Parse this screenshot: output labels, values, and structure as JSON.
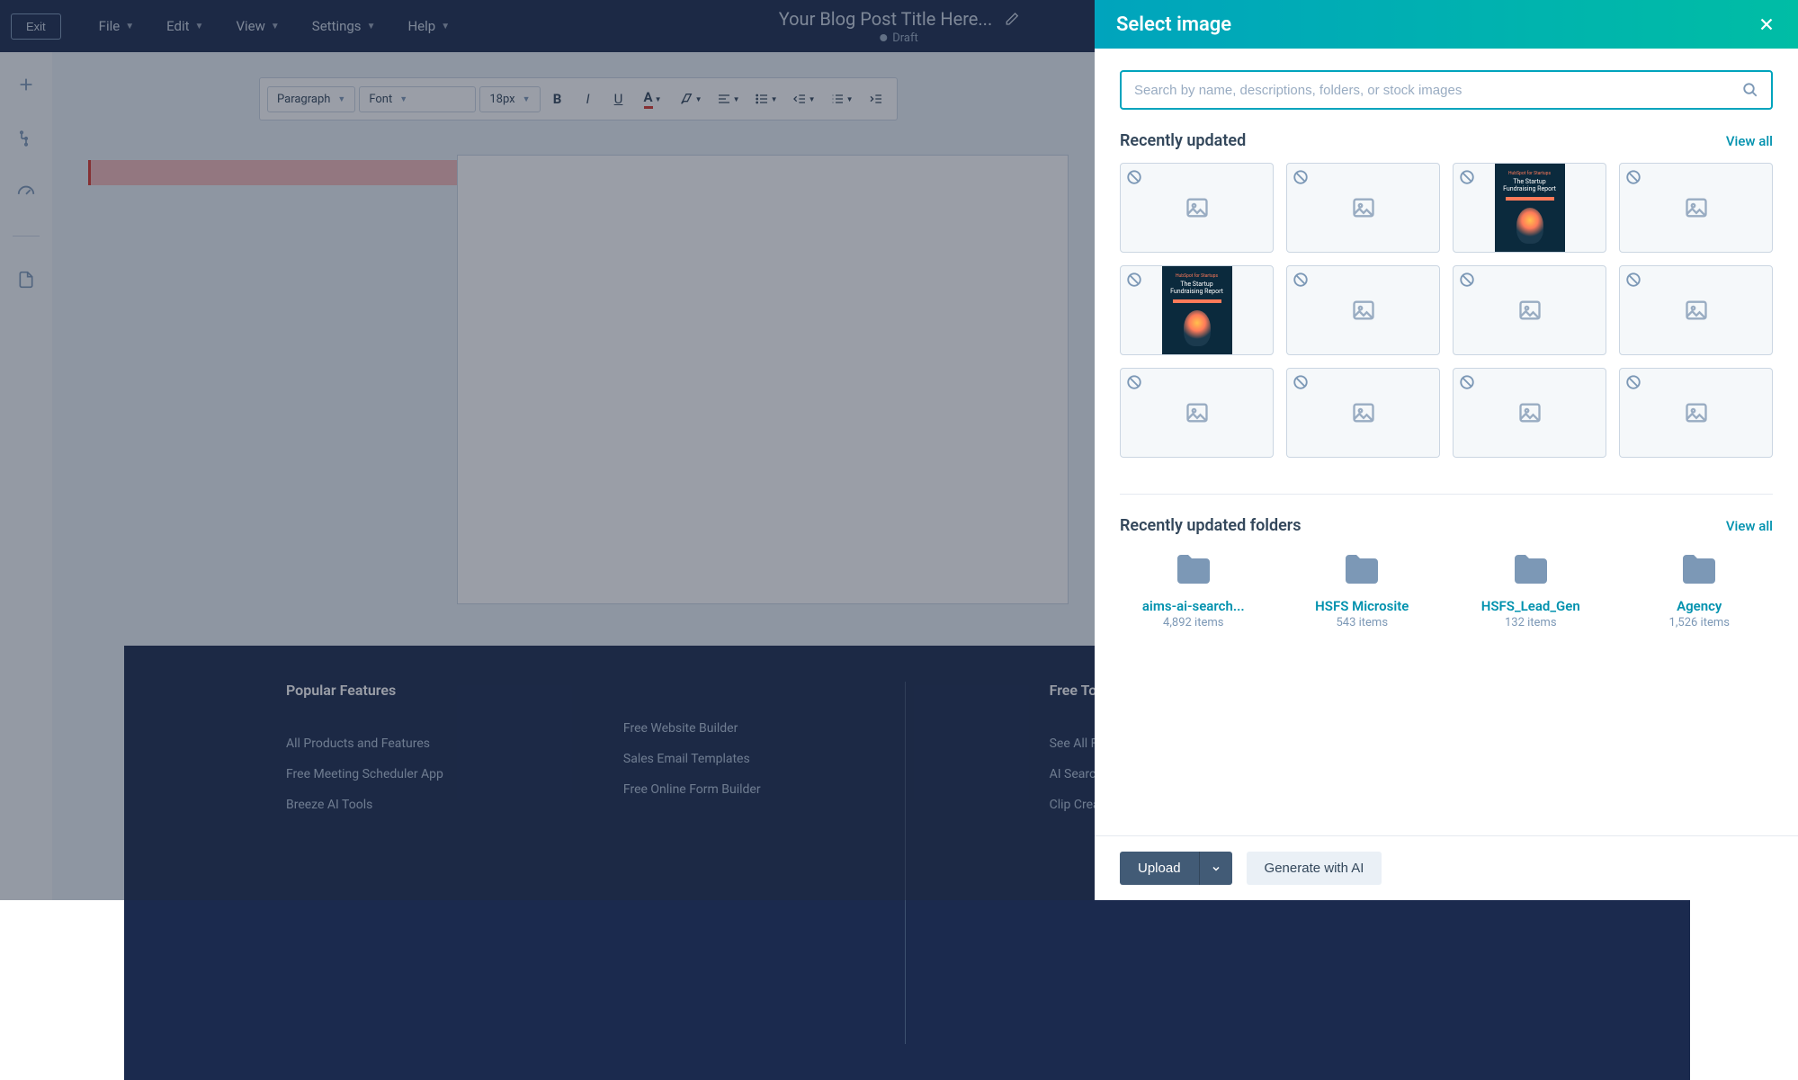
{
  "topbar": {
    "exit": "Exit",
    "menus": [
      "File",
      "Edit",
      "View",
      "Settings",
      "Help"
    ],
    "title": "Your Blog Post Title Here...",
    "status": "Draft"
  },
  "toolbar": {
    "paragraph": "Paragraph",
    "font": "Font",
    "size": "18px"
  },
  "footer": {
    "col1_title": "Popular Features",
    "col1_links": [
      "All Products and Features",
      "Free Meeting Scheduler App",
      "Breeze AI Tools"
    ],
    "col2_links": [
      "Free Website Builder",
      "Sales Email Templates",
      "Free Online Form Builder"
    ],
    "col3_title": "Free Tools",
    "col3_links": [
      "See All Free Business Tools",
      "AI Search Grader",
      "Clip Creator"
    ]
  },
  "panel": {
    "title": "Select image",
    "search_placeholder": "Search by name, descriptions, folders, or stock images",
    "section_recent": "Recently updated",
    "section_folders": "Recently updated folders",
    "view_all": "View all",
    "report_sub": "HubSpot for Startups",
    "report_title": "The Startup Fundraising Report",
    "thumbs": [
      {
        "preview": false
      },
      {
        "preview": false
      },
      {
        "preview": true
      },
      {
        "preview": false
      },
      {
        "preview": true
      },
      {
        "preview": false
      },
      {
        "preview": false
      },
      {
        "preview": false
      },
      {
        "preview": false
      },
      {
        "preview": false
      },
      {
        "preview": false
      },
      {
        "preview": false
      }
    ],
    "folders": [
      {
        "name": "aims-ai-search...",
        "count": "4,892 items"
      },
      {
        "name": "HSFS Microsite",
        "count": "543 items"
      },
      {
        "name": "HSFS_Lead_Gen",
        "count": "132 items"
      },
      {
        "name": "Agency",
        "count": "1,526 items"
      }
    ],
    "upload": "Upload",
    "gen_ai": "Generate with AI"
  }
}
